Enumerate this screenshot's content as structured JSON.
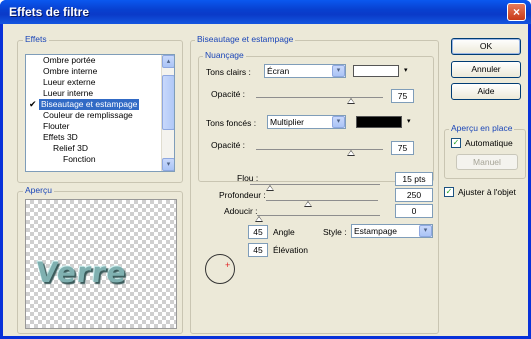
{
  "window": {
    "title": "Effets de filtre",
    "close_label": "×"
  },
  "effects": {
    "legend": "Effets",
    "items": [
      {
        "label": "Ombre portée",
        "checked": false,
        "selected": false,
        "indent": 0
      },
      {
        "label": "Ombre interne",
        "checked": false,
        "selected": false,
        "indent": 0
      },
      {
        "label": "Lueur externe",
        "checked": false,
        "selected": false,
        "indent": 0
      },
      {
        "label": "Lueur interne",
        "checked": false,
        "selected": false,
        "indent": 0
      },
      {
        "label": "Biseautage et estampage",
        "checked": true,
        "selected": true,
        "indent": 0
      },
      {
        "label": "Couleur de remplissage",
        "checked": false,
        "selected": false,
        "indent": 0
      },
      {
        "label": "Flouter",
        "checked": false,
        "selected": false,
        "indent": 0
      },
      {
        "label": "Effets 3D",
        "checked": false,
        "selected": false,
        "indent": 0
      },
      {
        "label": "Relief 3D",
        "checked": false,
        "selected": false,
        "indent": 1
      },
      {
        "label": "Fonction",
        "checked": false,
        "selected": false,
        "indent": 2
      }
    ],
    "check_mark": "✔"
  },
  "preview": {
    "legend": "Aperçu",
    "sample_text": "Verre"
  },
  "bevel": {
    "legend": "Biseautage et estampage",
    "shading": {
      "legend": "Nuançage",
      "highlights_label": "Tons clairs :",
      "highlights_mode": "Écran",
      "highlights_color": "#ffffff",
      "opacity1_label": "Opacité :",
      "opacity1_value": "75",
      "opacity1_level": 0.75,
      "shadows_label": "Tons foncés :",
      "shadows_mode": "Multiplier",
      "shadows_color": "#000000",
      "opacity2_label": "Opacité :",
      "opacity2_value": "75",
      "opacity2_level": 0.75
    },
    "blur_label": "Flou :",
    "blur_value": "15 pts",
    "depth_label": "Profondeur :",
    "depth_value": "250",
    "soften_label": "Adoucir :",
    "soften_value": "0",
    "angle_value": "45",
    "angle_label": "Angle",
    "elevation_value": "45",
    "elevation_label": "Élévation",
    "style_label": "Style :",
    "style_value": "Estampage"
  },
  "buttons": {
    "ok": "OK",
    "cancel": "Annuler",
    "help": "Aide"
  },
  "live_preview": {
    "legend": "Aperçu en place",
    "auto_label": "Automatique",
    "manual_label": "Manuel"
  },
  "fit_label": "Ajuster à l'objet",
  "icons": {
    "arrow_down": "▾",
    "arrow_up": "▴",
    "arrow_right": "▸",
    "check": "✓",
    "cross": "+"
  }
}
